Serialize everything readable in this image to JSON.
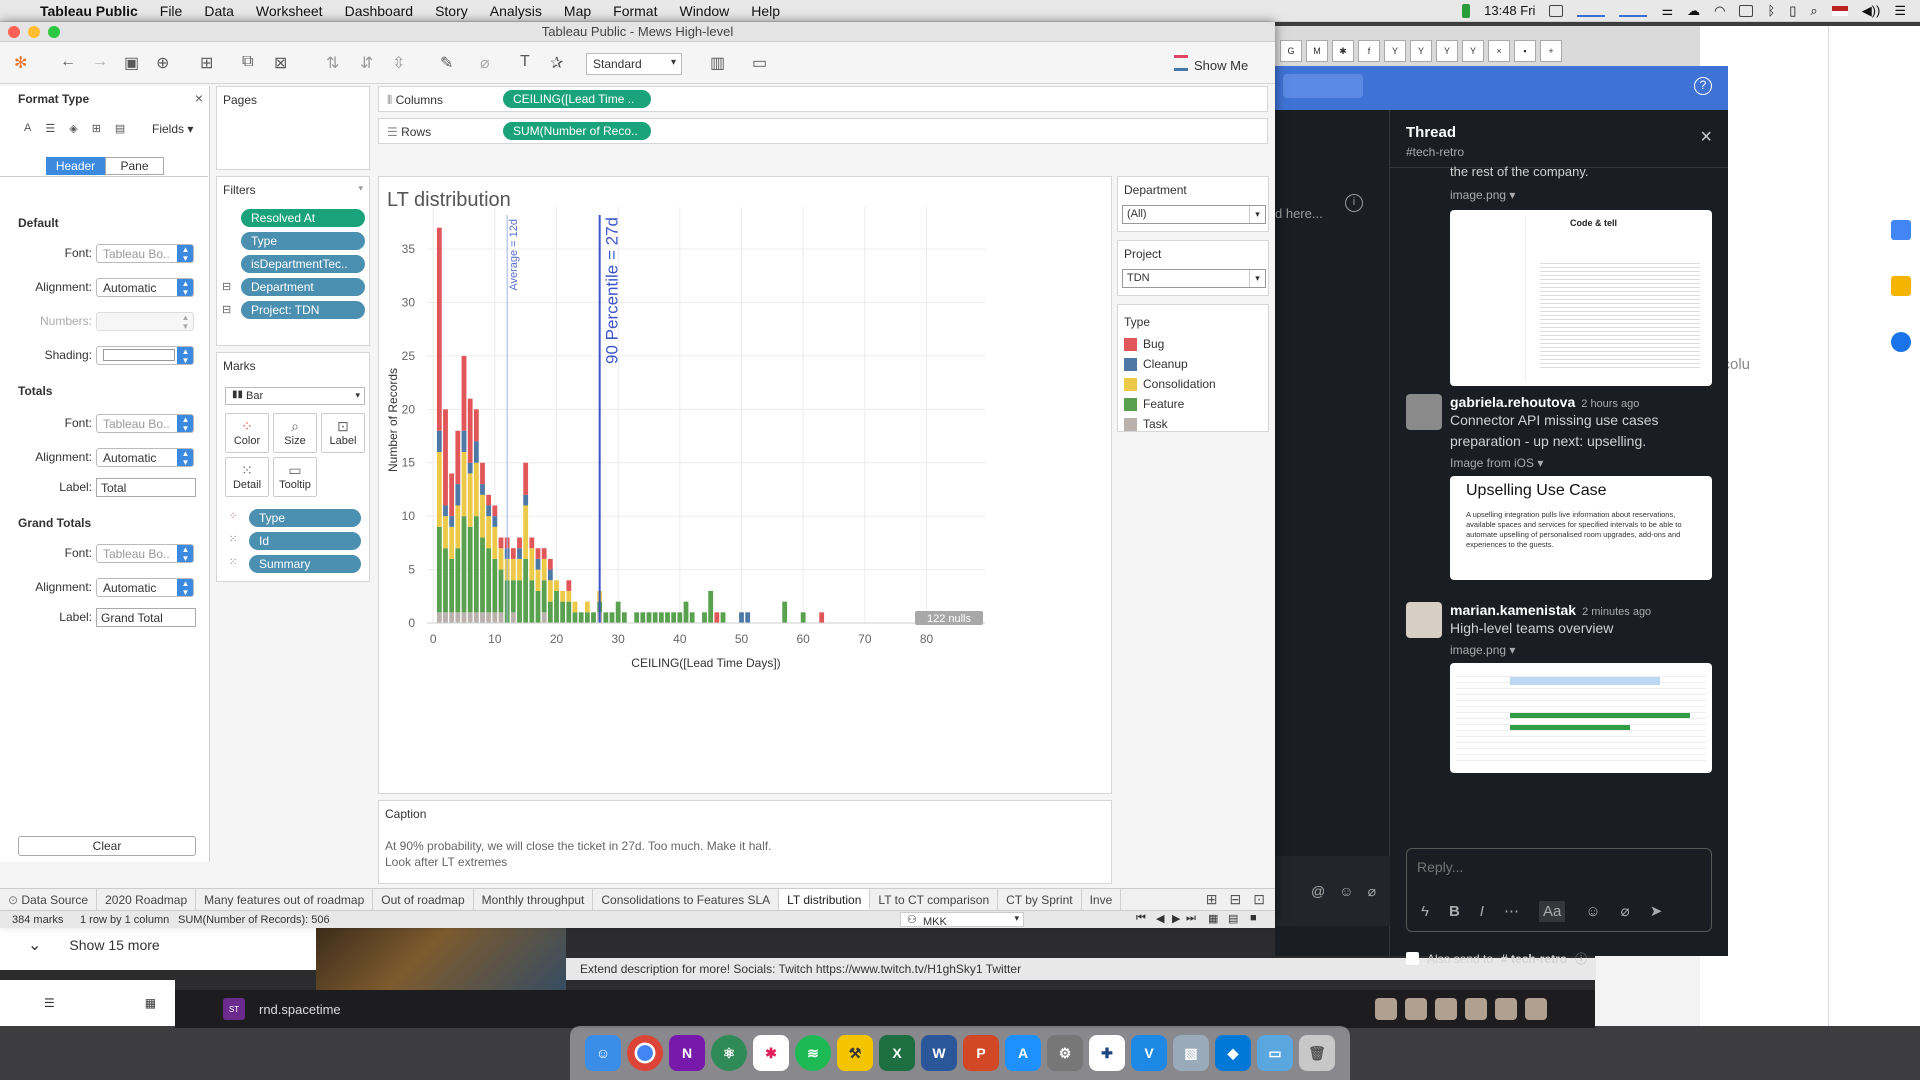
{
  "menubar": {
    "app": "Tableau Public",
    "items": [
      "File",
      "Data",
      "Worksheet",
      "Dashboard",
      "Story",
      "Analysis",
      "Map",
      "Format",
      "Window",
      "Help"
    ],
    "clock": "13:48 Fri"
  },
  "window": {
    "title": "Tableau Public - Mews High-level"
  },
  "toolbar": {
    "fit": "Standard",
    "show_me": "Show Me"
  },
  "format_pane": {
    "title": "Format Type",
    "fields_label": "Fields ▾",
    "tabs": [
      "Header",
      "Pane"
    ],
    "active_tab": "Header",
    "sections": {
      "default": {
        "title": "Default",
        "font_label": "Font:",
        "font_value": "Tableau Bo..",
        "alignment_label": "Alignment:",
        "alignment_value": "Automatic",
        "numbers_label": "Numbers:",
        "shading_label": "Shading:"
      },
      "totals": {
        "title": "Totals",
        "font_label": "Font:",
        "font_value": "Tableau Bo..",
        "alignment_label": "Alignment:",
        "alignment_value": "Automatic",
        "label_label": "Label:",
        "label_value": "Total"
      },
      "grand_totals": {
        "title": "Grand Totals",
        "font_label": "Font:",
        "font_value": "Tableau Bo..",
        "alignment_label": "Alignment:",
        "alignment_value": "Automatic",
        "label_label": "Label:",
        "label_value": "Grand Total"
      }
    },
    "clear_button": "Clear"
  },
  "pages_card": {
    "title": "Pages"
  },
  "filters_card": {
    "title": "Filters",
    "items": [
      "Resolved At",
      "Type",
      "isDepartmentTec..",
      "Department",
      "Project: TDN"
    ]
  },
  "marks_card": {
    "title": "Marks",
    "mark_type": "Bar",
    "buttons": [
      "Color",
      "Size",
      "Label",
      "Detail",
      "Tooltip"
    ],
    "fields": [
      "Type",
      "Id",
      "Summary"
    ]
  },
  "shelves": {
    "columns_label": "Columns",
    "columns_pill": "CEILING([Lead Time ..",
    "rows_label": "Rows",
    "rows_pill": "SUM(Number of Reco.."
  },
  "department_filter": {
    "title": "Department",
    "value": "(All)"
  },
  "project_filter": {
    "title": "Project",
    "value": "TDN"
  },
  "type_legend": {
    "title": "Type",
    "items": [
      {
        "name": "Bug",
        "color": "#e15759"
      },
      {
        "name": "Cleanup",
        "color": "#4e79a7"
      },
      {
        "name": "Consolidation",
        "color": "#edc948"
      },
      {
        "name": "Feature",
        "color": "#59a14f"
      },
      {
        "name": "Task",
        "color": "#bab0ac"
      }
    ]
  },
  "chart_data": {
    "type": "bar",
    "title": "LT distribution",
    "xlabel": "CEILING([Lead Time Days])",
    "ylabel": "Number of Records",
    "xlim": [
      0,
      80
    ],
    "ylim": [
      0,
      38
    ],
    "xticks": [
      0,
      10,
      20,
      30,
      40,
      50,
      60,
      70,
      80
    ],
    "yticks": [
      0,
      5,
      10,
      15,
      20,
      25,
      30,
      35
    ],
    "grid": true,
    "stacked": true,
    "series_order": [
      "Task",
      "Feature",
      "Consolidation",
      "Cleanup",
      "Bug"
    ],
    "colors": {
      "Bug": "#e15759",
      "Cleanup": "#4e79a7",
      "Consolidation": "#edc948",
      "Feature": "#59a14f",
      "Task": "#bab0ac"
    },
    "bars": [
      {
        "x": 1,
        "Task": 1,
        "Feature": 8,
        "Consolidation": 7,
        "Cleanup": 2,
        "Bug": 19
      },
      {
        "x": 2,
        "Task": 1,
        "Feature": 6,
        "Consolidation": 3,
        "Cleanup": 1,
        "Bug": 9
      },
      {
        "x": 3,
        "Task": 1,
        "Feature": 5,
        "Consolidation": 3,
        "Cleanup": 1,
        "Bug": 4
      },
      {
        "x": 4,
        "Task": 1,
        "Feature": 6,
        "Consolidation": 4,
        "Cleanup": 2,
        "Bug": 5
      },
      {
        "x": 5,
        "Task": 1,
        "Feature": 9,
        "Consolidation": 6,
        "Cleanup": 2,
        "Bug": 7
      },
      {
        "x": 6,
        "Task": 1,
        "Feature": 8,
        "Consolidation": 5,
        "Cleanup": 1,
        "Bug": 6
      },
      {
        "x": 7,
        "Task": 1,
        "Feature": 9,
        "Consolidation": 5,
        "Cleanup": 2,
        "Bug": 3
      },
      {
        "x": 8,
        "Task": 1,
        "Feature": 7,
        "Consolidation": 4,
        "Cleanup": 1,
        "Bug": 2
      },
      {
        "x": 9,
        "Task": 1,
        "Feature": 6,
        "Consolidation": 3,
        "Cleanup": 1,
        "Bug": 1
      },
      {
        "x": 10,
        "Task": 1,
        "Feature": 5,
        "Consolidation": 3,
        "Cleanup": 1,
        "Bug": 1
      },
      {
        "x": 11,
        "Task": 1,
        "Feature": 4,
        "Consolidation": 2,
        "Cleanup": 0,
        "Bug": 1
      },
      {
        "x": 12,
        "Task": 0,
        "Feature": 4,
        "Consolidation": 2,
        "Cleanup": 1,
        "Bug": 1
      },
      {
        "x": 13,
        "Task": 1,
        "Feature": 3,
        "Consolidation": 2,
        "Cleanup": 0,
        "Bug": 1
      },
      {
        "x": 14,
        "Task": 0,
        "Feature": 4,
        "Consolidation": 2,
        "Cleanup": 1,
        "Bug": 1
      },
      {
        "x": 15,
        "Task": 0,
        "Feature": 6,
        "Consolidation": 5,
        "Cleanup": 1,
        "Bug": 3
      },
      {
        "x": 16,
        "Task": 0,
        "Feature": 4,
        "Consolidation": 3,
        "Cleanup": 0,
        "Bug": 1
      },
      {
        "x": 17,
        "Task": 0,
        "Feature": 3,
        "Consolidation": 2,
        "Cleanup": 1,
        "Bug": 1
      },
      {
        "x": 18,
        "Task": 1,
        "Feature": 3,
        "Consolidation": 2,
        "Cleanup": 0,
        "Bug": 1
      },
      {
        "x": 19,
        "Task": 0,
        "Feature": 2,
        "Consolidation": 2,
        "Cleanup": 1,
        "Bug": 1
      },
      {
        "x": 20,
        "Task": 0,
        "Feature": 3,
        "Consolidation": 1,
        "Cleanup": 0,
        "Bug": 0
      },
      {
        "x": 21,
        "Task": 0,
        "Feature": 2,
        "Consolidation": 1,
        "Cleanup": 0,
        "Bug": 0
      },
      {
        "x": 22,
        "Task": 0,
        "Feature": 2,
        "Consolidation": 1,
        "Cleanup": 0,
        "Bug": 1
      },
      {
        "x": 23,
        "Task": 0,
        "Feature": 1,
        "Consolidation": 1,
        "Cleanup": 0,
        "Bug": 0
      },
      {
        "x": 24,
        "Task": 0,
        "Feature": 1,
        "Consolidation": 0,
        "Cleanup": 0,
        "Bug": 0
      },
      {
        "x": 25,
        "Task": 0,
        "Feature": 1,
        "Consolidation": 1,
        "Cleanup": 0,
        "Bug": 0
      },
      {
        "x": 26,
        "Task": 0,
        "Feature": 1,
        "Consolidation": 0,
        "Cleanup": 0,
        "Bug": 0
      },
      {
        "x": 27,
        "Task": 1,
        "Feature": 1,
        "Consolidation": 1,
        "Cleanup": 0,
        "Bug": 0
      },
      {
        "x": 28,
        "Task": 0,
        "Feature": 1,
        "Consolidation": 0,
        "Cleanup": 0,
        "Bug": 0
      },
      {
        "x": 29,
        "Task": 0,
        "Feature": 1,
        "Consolidation": 0,
        "Cleanup": 0,
        "Bug": 0
      },
      {
        "x": 30,
        "Task": 0,
        "Feature": 2,
        "Consolidation": 0,
        "Cleanup": 0,
        "Bug": 0
      },
      {
        "x": 31,
        "Task": 0,
        "Feature": 1,
        "Consolidation": 0,
        "Cleanup": 0,
        "Bug": 0
      },
      {
        "x": 33,
        "Task": 0,
        "Feature": 1,
        "Consolidation": 0,
        "Cleanup": 0,
        "Bug": 0
      },
      {
        "x": 34,
        "Task": 0,
        "Feature": 1,
        "Consolidation": 0,
        "Cleanup": 0,
        "Bug": 0
      },
      {
        "x": 35,
        "Task": 0,
        "Feature": 1,
        "Consolidation": 0,
        "Cleanup": 0,
        "Bug": 0
      },
      {
        "x": 36,
        "Task": 0,
        "Feature": 1,
        "Consolidation": 0,
        "Cleanup": 0,
        "Bug": 0
      },
      {
        "x": 37,
        "Task": 0,
        "Feature": 1,
        "Consolidation": 0,
        "Cleanup": 0,
        "Bug": 0
      },
      {
        "x": 38,
        "Task": 0,
        "Feature": 1,
        "Consolidation": 0,
        "Cleanup": 0,
        "Bug": 0
      },
      {
        "x": 39,
        "Task": 0,
        "Feature": 1,
        "Consolidation": 0,
        "Cleanup": 0,
        "Bug": 0
      },
      {
        "x": 40,
        "Task": 0,
        "Feature": 1,
        "Consolidation": 0,
        "Cleanup": 0,
        "Bug": 0
      },
      {
        "x": 41,
        "Task": 0,
        "Feature": 2,
        "Consolidation": 0,
        "Cleanup": 0,
        "Bug": 0
      },
      {
        "x": 42,
        "Task": 0,
        "Feature": 1,
        "Consolidation": 0,
        "Cleanup": 0,
        "Bug": 0
      },
      {
        "x": 44,
        "Task": 0,
        "Feature": 1,
        "Consolidation": 0,
        "Cleanup": 0,
        "Bug": 0
      },
      {
        "x": 45,
        "Task": 0,
        "Feature": 3,
        "Consolidation": 0,
        "Cleanup": 0,
        "Bug": 0
      },
      {
        "x": 46,
        "Task": 0,
        "Feature": 0,
        "Consolidation": 0,
        "Cleanup": 0,
        "Bug": 1
      },
      {
        "x": 47,
        "Task": 0,
        "Feature": 1,
        "Consolidation": 0,
        "Cleanup": 0,
        "Bug": 0
      },
      {
        "x": 50,
        "Task": 0,
        "Feature": 0,
        "Consolidation": 0,
        "Cleanup": 1,
        "Bug": 0
      },
      {
        "x": 51,
        "Task": 0,
        "Feature": 0,
        "Consolidation": 0,
        "Cleanup": 1,
        "Bug": 0
      },
      {
        "x": 57,
        "Task": 0,
        "Feature": 2,
        "Consolidation": 0,
        "Cleanup": 0,
        "Bug": 0
      },
      {
        "x": 60,
        "Task": 0,
        "Feature": 1,
        "Consolidation": 0,
        "Cleanup": 0,
        "Bug": 0
      },
      {
        "x": 63,
        "Task": 0,
        "Feature": 0,
        "Consolidation": 0,
        "Cleanup": 0,
        "Bug": 1
      },
      {
        "x": 80,
        "Task": 0,
        "Feature": 1,
        "Consolidation": 0,
        "Cleanup": 0,
        "Bug": 0
      }
    ],
    "reference_lines": [
      {
        "x": 12,
        "label": "Average = 12d"
      },
      {
        "x": 27,
        "label": "90 Percentile = 27d"
      }
    ],
    "nulls_badge": "122 nulls"
  },
  "caption": {
    "title": "Caption",
    "lines": [
      "At 90% probability, we will close the ticket in 27d. Too much. Make it half.",
      "Look after LT extremes"
    ]
  },
  "sheet_tabs": {
    "data_source": "Data Source",
    "tabs": [
      "2020 Roadmap",
      "Many features out of roadmap",
      "Out of roadmap",
      "Monthly throughput",
      "Consolidations to Features SLA",
      "LT distribution",
      "LT to CT comparison",
      "CT by Sprint",
      "Inve"
    ],
    "active": "LT distribution"
  },
  "status_bar": {
    "marks": "384 marks",
    "rows_cols": "1 row by 1 column",
    "sum": "SUM(Number of Records): 506",
    "user": "MKK"
  },
  "slack": {
    "search_hint": "d here...",
    "thread_title": "Thread",
    "channel": "#tech-retro",
    "cut_text": "the rest of the company.",
    "img1_label": "image.png ▾",
    "card1_title": "Code & tell",
    "msg1": {
      "author": "gabriela.rehoutova",
      "time": "2 hours ago",
      "text": "Connector API missing use cases preparation - up next: upselling.",
      "img_label": "Image from iOS ▾",
      "card_title": "Upselling Use Case",
      "card_text": "A upselling integration pulls live information about reservations, available spaces and services for specified intervals to be able to automate upselling of personalised room upgrades, add-ons and experiences to the guests."
    },
    "msg2": {
      "author": "marian.kamenistak",
      "time": "2 minutes ago",
      "text": "High-level teams overview",
      "img_label": "image.png ▾"
    },
    "reply_placeholder": "Reply...",
    "also_send": "Also send to",
    "also_send_channel": "# tech-retro"
  },
  "background": {
    "show_more": "Show 15 more",
    "video_desc": "Extend description for more! Socials: Twitch https://www.twitch.tv/H1ghSky1 Twitter",
    "workspace": "rnd.spacetime",
    "peek_text": "d colu"
  }
}
